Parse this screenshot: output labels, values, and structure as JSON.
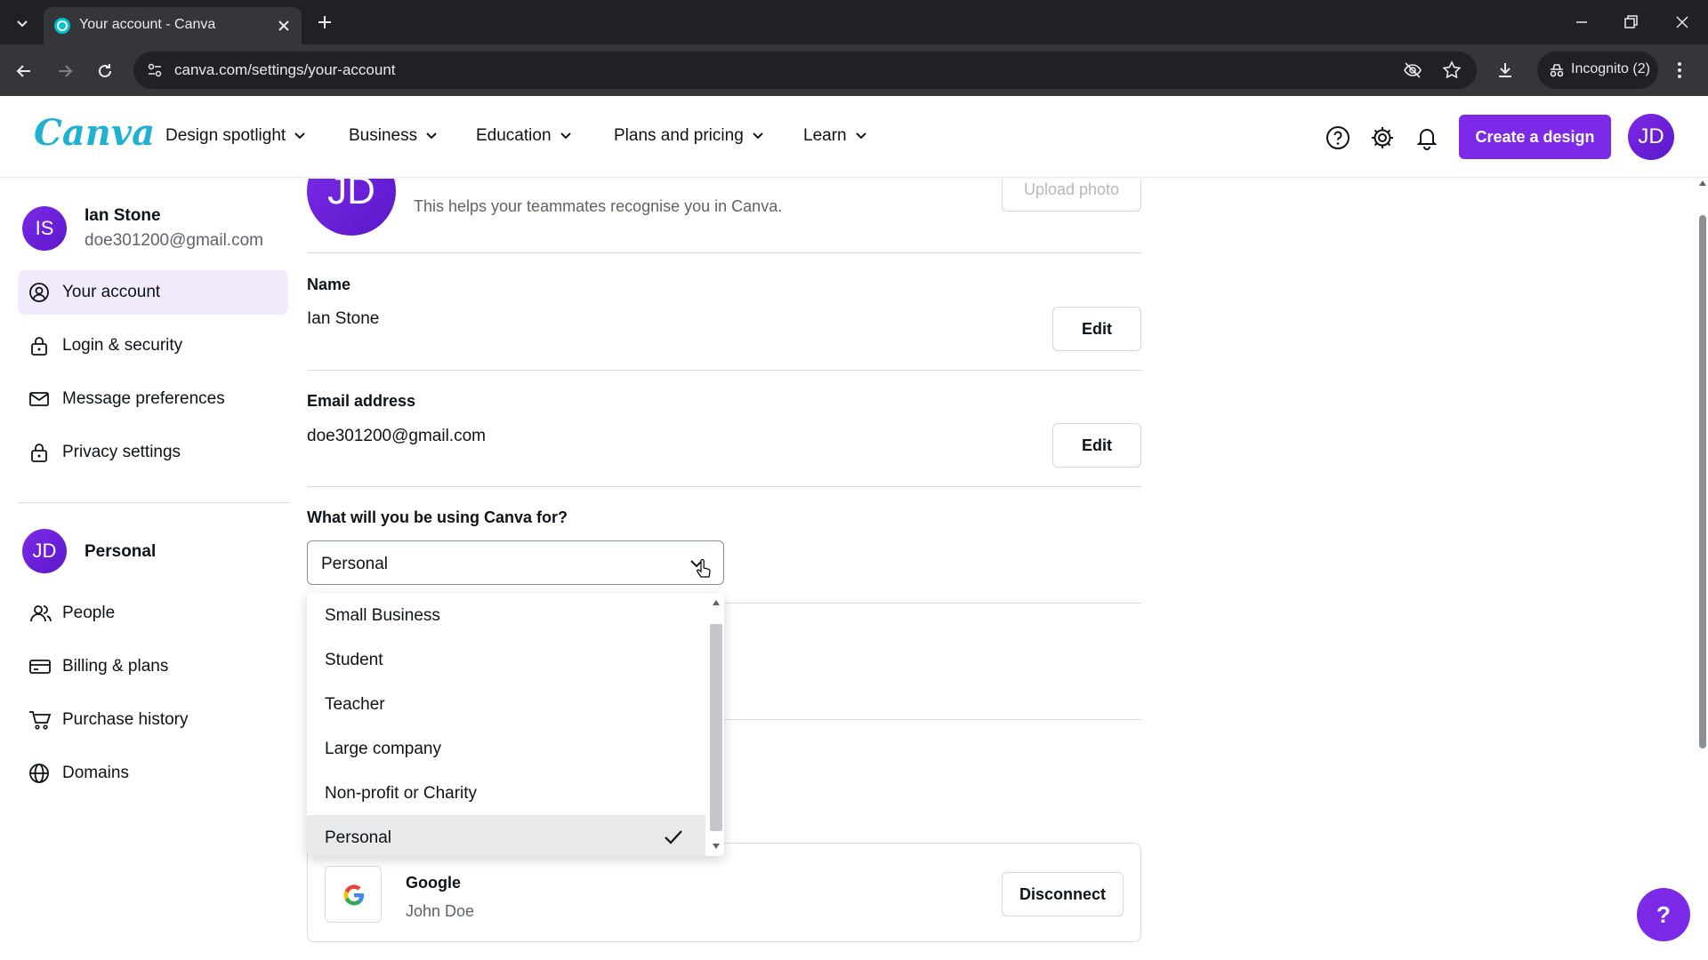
{
  "browser": {
    "tab_title": "Your account - Canva",
    "url": "canva.com/settings/your-account",
    "incognito_label": "Incognito (2)"
  },
  "header": {
    "logo": "Canva",
    "nav": [
      "Design spotlight",
      "Business",
      "Education",
      "Plans and pricing",
      "Learn"
    ],
    "create_button": "Create a design",
    "avatar_initials": "JD",
    "brand_color": "#7d2ae8"
  },
  "sidebar": {
    "user": {
      "initials": "IS",
      "name": "Ian Stone",
      "email": "doe301200@gmail.com"
    },
    "account_items": [
      {
        "label": "Your account",
        "icon": "user-circle-icon",
        "active": true
      },
      {
        "label": "Login & security",
        "icon": "lock-icon",
        "active": false
      },
      {
        "label": "Message preferences",
        "icon": "envelope-icon",
        "active": false
      },
      {
        "label": "Privacy settings",
        "icon": "lock-icon",
        "active": false
      }
    ],
    "team": {
      "initials": "JD",
      "name": "Personal"
    },
    "team_items": [
      {
        "label": "People",
        "icon": "people-icon"
      },
      {
        "label": "Billing & plans",
        "icon": "credit-card-icon"
      },
      {
        "label": "Purchase history",
        "icon": "cart-icon"
      },
      {
        "label": "Domains",
        "icon": "globe-icon"
      }
    ]
  },
  "main": {
    "profile": {
      "initials": "JD",
      "helper": "This helps your teammates recognise you in Canva.",
      "upload_button": "Upload photo"
    },
    "name": {
      "label": "Name",
      "value": "Ian Stone",
      "edit": "Edit"
    },
    "email": {
      "label": "Email address",
      "value": "doe301200@gmail.com",
      "edit": "Edit"
    },
    "usage": {
      "label": "What will you be using Canva for?",
      "selected": "Personal",
      "options": [
        "Small Business",
        "Student",
        "Teacher",
        "Large company",
        "Non-profit or Charity",
        "Personal"
      ]
    },
    "connected": {
      "provider": "Google",
      "account": "John Doe",
      "button": "Disconnect"
    }
  },
  "help_fab": "?"
}
